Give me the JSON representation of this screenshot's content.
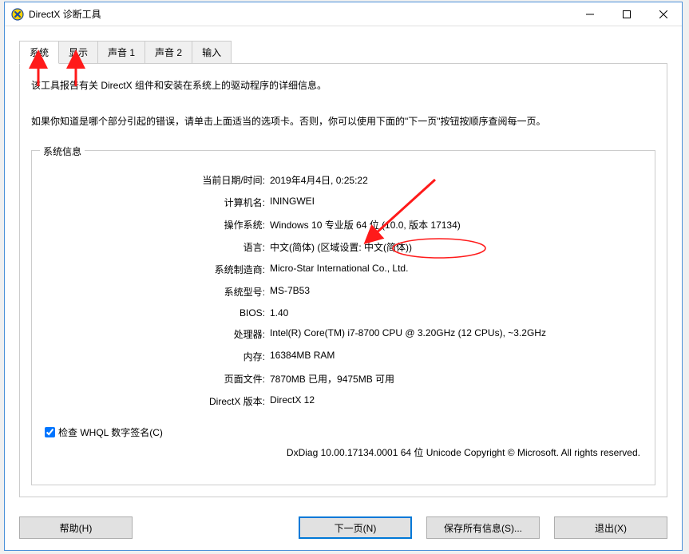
{
  "window": {
    "title": "DirectX 诊断工具"
  },
  "tabs": {
    "items": [
      {
        "label": "系统"
      },
      {
        "label": "显示"
      },
      {
        "label": "声音 1"
      },
      {
        "label": "声音 2"
      },
      {
        "label": "输入"
      }
    ]
  },
  "intro": {
    "line1": "该工具报告有关 DirectX 组件和安装在系统上的驱动程序的详细信息。",
    "line2": "如果你知道是哪个部分引起的错误，请单击上面适当的选项卡。否则，你可以使用下面的\"下一页\"按钮按顺序查阅每一页。"
  },
  "group": {
    "title": "系统信息",
    "rows": [
      {
        "label": "当前日期/时间:",
        "value": "2019年4月4日, 0:25:22"
      },
      {
        "label": "计算机名:",
        "value": "ININGWEI"
      },
      {
        "label": "操作系统:",
        "value": "Windows 10 专业版 64 位 (10.0, 版本 17134)"
      },
      {
        "label": "语言:",
        "value": "中文(简体) (区域设置: 中文(简体))"
      },
      {
        "label": "系统制造商:",
        "value": "Micro-Star International Co., Ltd."
      },
      {
        "label": "系统型号:",
        "value": "MS-7B53"
      },
      {
        "label": "BIOS:",
        "value": "1.40"
      },
      {
        "label": "处理器:",
        "value": "Intel(R) Core(TM) i7-8700 CPU @ 3.20GHz (12 CPUs), ~3.2GHz"
      },
      {
        "label": "内存:",
        "value": "16384MB RAM"
      },
      {
        "label": "页面文件:",
        "value": "7870MB 已用，9475MB 可用"
      },
      {
        "label": "DirectX 版本:",
        "value": "DirectX 12"
      }
    ],
    "checkbox_label": "检查 WHQL 数字签名(C)",
    "footer": "DxDiag 10.00.17134.0001 64 位 Unicode  Copyright © Microsoft. All rights reserved."
  },
  "buttons": {
    "help": "帮助(H)",
    "next": "下一页(N)",
    "save": "保存所有信息(S)...",
    "exit": "退出(X)"
  }
}
